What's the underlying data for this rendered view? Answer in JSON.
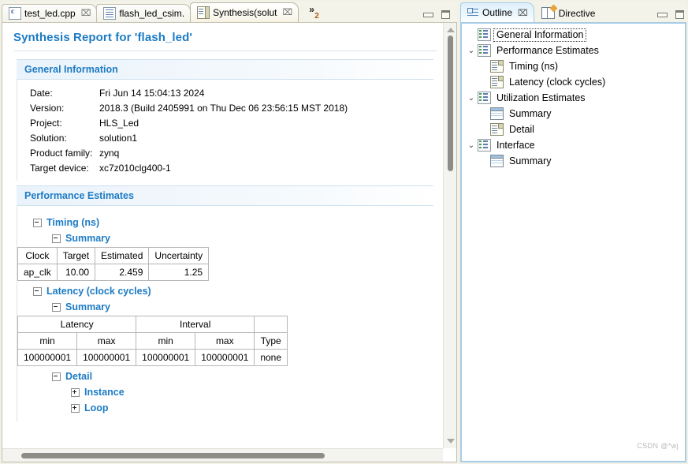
{
  "editor": {
    "tabs": [
      {
        "label": "test_led.cpp",
        "icon": "c-file-icon",
        "closeable": true,
        "active": false
      },
      {
        "label": "flash_led_csim.",
        "icon": "text-file-icon",
        "closeable": false,
        "active": false
      },
      {
        "label": "Synthesis(solut",
        "icon": "synthesis-report-icon",
        "closeable": true,
        "active": true
      }
    ],
    "overflow": {
      "chevron": "»",
      "count": "2"
    },
    "view_buttons": {
      "minimize": "Minimize",
      "maximize": "Maximize"
    },
    "close_glyph": "⌧"
  },
  "report": {
    "title": "Synthesis Report for 'flash_led'",
    "general_information": {
      "heading": "General Information",
      "rows": [
        {
          "key": "Date:",
          "value": "Fri Jun 14 15:04:13 2024"
        },
        {
          "key": "Version:",
          "value": "2018.3 (Build 2405991 on Thu Dec 06 23:56:15 MST 2018)"
        },
        {
          "key": "Project:",
          "value": "HLS_Led"
        },
        {
          "key": "Solution:",
          "value": "solution1"
        },
        {
          "key": "Product family:",
          "value": "zynq"
        },
        {
          "key": "Target device:",
          "value": "xc7z010clg400-1"
        }
      ]
    },
    "performance_estimates": {
      "heading": "Performance Estimates",
      "timing": {
        "label": "Timing (ns)",
        "summary_label": "Summary",
        "table": {
          "headers": [
            "Clock",
            "Target",
            "Estimated",
            "Uncertainty"
          ],
          "rows": [
            [
              "ap_clk",
              "10.00",
              "2.459",
              "1.25"
            ]
          ]
        }
      },
      "latency": {
        "label": "Latency (clock cycles)",
        "summary_label": "Summary",
        "table": {
          "group_headers": [
            "Latency",
            "Interval",
            ""
          ],
          "headers": [
            "min",
            "max",
            "min",
            "max",
            "Type"
          ],
          "rows": [
            [
              "100000001",
              "100000001",
              "100000001",
              "100000001",
              "none"
            ]
          ]
        },
        "detail_label": "Detail",
        "detail_children": [
          "Instance",
          "Loop"
        ]
      }
    }
  },
  "outline": {
    "tabs": [
      {
        "label": "Outline",
        "icon": "outline-icon",
        "active": true,
        "closeable": true
      },
      {
        "label": "Directive",
        "icon": "directive-icon",
        "active": false,
        "closeable": false
      }
    ],
    "close_glyph": "⌧",
    "items": [
      {
        "label": "General Information",
        "icon": "category-icon",
        "indent": 1,
        "arrow": "",
        "selected": true
      },
      {
        "label": "Performance Estimates",
        "icon": "category-icon",
        "indent": 0,
        "arrow": "⌄",
        "selected": false
      },
      {
        "label": "Timing (ns)",
        "icon": "page-icon",
        "indent": 2,
        "arrow": "",
        "selected": false
      },
      {
        "label": "Latency (clock cycles)",
        "icon": "page-icon",
        "indent": 2,
        "arrow": "",
        "selected": false
      },
      {
        "label": "Utilization Estimates",
        "icon": "category-icon",
        "indent": 0,
        "arrow": "⌄",
        "selected": false
      },
      {
        "label": "Summary",
        "icon": "table-icon",
        "indent": 2,
        "arrow": "",
        "selected": false
      },
      {
        "label": "Detail",
        "icon": "page-icon",
        "indent": 2,
        "arrow": "",
        "selected": false
      },
      {
        "label": "Interface",
        "icon": "category-icon",
        "indent": 0,
        "arrow": "⌄",
        "selected": false
      },
      {
        "label": "Summary",
        "icon": "table-icon",
        "indent": 2,
        "arrow": "",
        "selected": false
      }
    ]
  },
  "watermark": "CSDN @*wj",
  "colors": {
    "accent_blue": "#1d7bc4",
    "tab_active_bg": "#fbfaf2",
    "outline_tab_bg": "#dff0fb",
    "section_header_bg": "#eaf3fb"
  }
}
